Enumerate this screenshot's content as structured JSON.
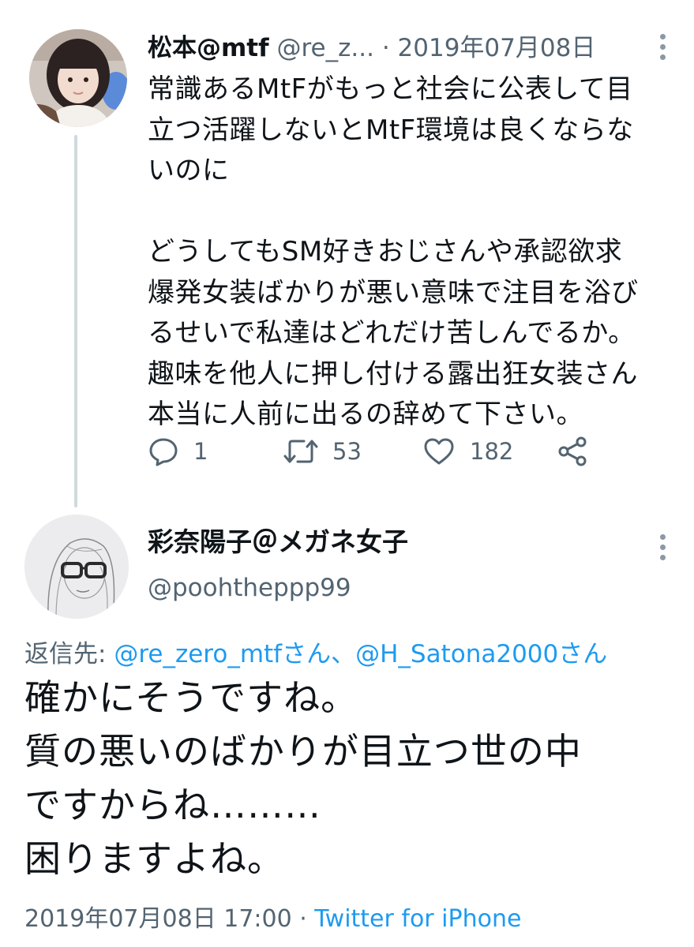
{
  "tweet1": {
    "author_name": "松本@mtf",
    "author_handle": "@re_z...",
    "separator": "·",
    "date": "2019年07月08日",
    "text_lines": [
      "常識あるMtFがもっと社会に公表して目",
      "立つ活躍しないとMtF環境は良くならな",
      "いのに",
      "",
      "どうしてもSM好きおじさんや承認欲求",
      "爆発女装ばかりが悪い意味で注目を浴び",
      "るせいで私達はどれだけ苦しんでるか。",
      "趣味を他人に押し付ける露出狂女装さん",
      "本当に人前に出るの辞めて下さい。"
    ],
    "replies": "1",
    "retweets": "53",
    "likes": "182"
  },
  "tweet2": {
    "author_name": "彩奈陽子＠メガネ女子",
    "author_handle": "@poohtheppp99",
    "reply_to_label": "返信先: ",
    "reply_to_mention1": "@re_zero_mtfさん",
    "reply_to_sep": "、",
    "reply_to_mention2": "@H_Satona2000さん",
    "text_lines": [
      "確かにそうですね。",
      "質の悪いのばかりが目立つ世の中",
      "ですからね………",
      "困りますよね。"
    ],
    "timestamp": "2019年07月08日 17:00",
    "meta_separator": " · ",
    "source": "Twitter for iPhone"
  },
  "colors": {
    "text": "#0f1419",
    "secondary": "#536471",
    "link": "#1d9bf0",
    "thread_line": "#cfd9de"
  },
  "icons": {
    "reply": "speech-bubble-icon",
    "retweet": "retweet-arrows-icon",
    "like": "heart-outline-icon",
    "share": "share-nodes-icon",
    "more": "vertical-dots-icon"
  }
}
